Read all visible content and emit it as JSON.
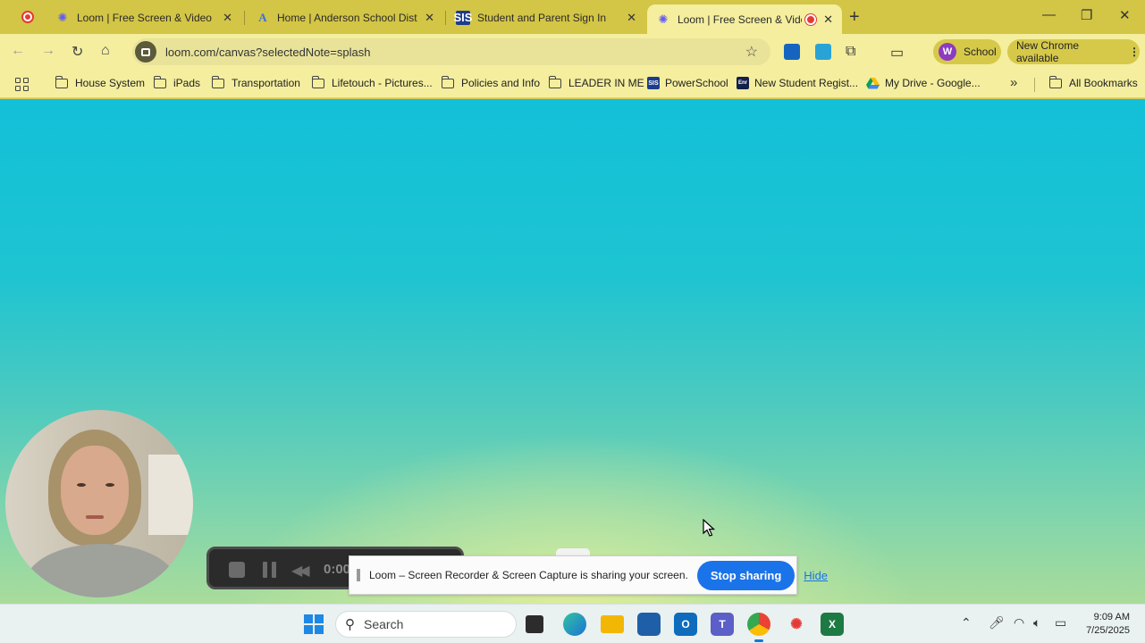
{
  "browser": {
    "tabs": [
      {
        "label": "Loom | Free Screen & Video Re",
        "favicon": "loom-icon"
      },
      {
        "label": "Home | Anderson School Distric",
        "favicon": "a-icon"
      },
      {
        "label": "Student and Parent Sign In",
        "favicon": "sis-icon"
      },
      {
        "label": "Loom | Free Screen & Video",
        "favicon": "loom-icon",
        "recording": true
      }
    ],
    "url": "loom.com/canvas?selectedNote=splash",
    "profile_initial": "W",
    "profile_label": "School",
    "update_label": "New Chrome available"
  },
  "bookmarks": [
    {
      "label": "House System",
      "type": "folder"
    },
    {
      "label": "iPads",
      "type": "folder"
    },
    {
      "label": "Transportation",
      "type": "folder"
    },
    {
      "label": "Lifetouch - Pictures...",
      "type": "folder"
    },
    {
      "label": "Policies and Info",
      "type": "folder"
    },
    {
      "label": "LEADER IN ME",
      "type": "folder"
    },
    {
      "label": "PowerSchool",
      "type": "site",
      "icon_text": "SIS",
      "icon_color": "#1e3c8c"
    },
    {
      "label": "New Student Regist...",
      "type": "site",
      "icon_text": "Enr",
      "icon_color": "#12204a"
    },
    {
      "label": "My Drive - Google...",
      "type": "site",
      "icon": "google-drive-icon"
    },
    {
      "label": "All Bookmarks",
      "type": "folder"
    }
  ],
  "loom": {
    "timer": "0:00",
    "share_message": "Loom – Screen Recorder & Screen Capture is sharing your screen.",
    "stop_label": "Stop sharing",
    "hide_label": "Hide"
  },
  "taskbar": {
    "search_placeholder": "Search",
    "time": "9:09 AM",
    "date": "7/25/2025"
  },
  "colors": {
    "tabstrip": "#d3c545",
    "toolbar": "#f4ee9e",
    "accent_blue": "#1a73e8",
    "canvas_top": "#12c0d8",
    "canvas_bottom": "#e8ee9a"
  }
}
